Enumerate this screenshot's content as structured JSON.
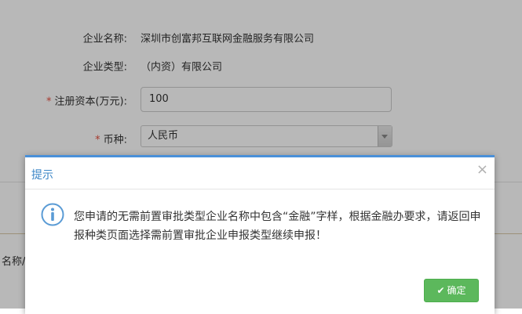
{
  "form": {
    "company_name_label": "企业名称:",
    "company_name_value": "深圳市创富邦互联网金融服务有限公司",
    "company_type_label": "企业类型:",
    "company_type_value": "（内资）有限公司",
    "capital_required": "*",
    "capital_label": "注册资本(万元):",
    "capital_value": "100",
    "currency_required": "*",
    "currency_label": "币种:",
    "currency_value": "人民币"
  },
  "background_section": {
    "partial_label": "名称/"
  },
  "dialog": {
    "title": "提示",
    "close_symbol": "×",
    "message": "您申请的无需前置审批类型企业名称中包含“金融”字样，根据金融办要求，请返回申报种类页面选择需前置审批企业申报类型继续申报！",
    "ok_check": "✔",
    "ok_label": "确定"
  },
  "colors": {
    "title_blue": "#3a85c6",
    "ok_green": "#5cb85c",
    "required_red": "#e74c3c"
  }
}
